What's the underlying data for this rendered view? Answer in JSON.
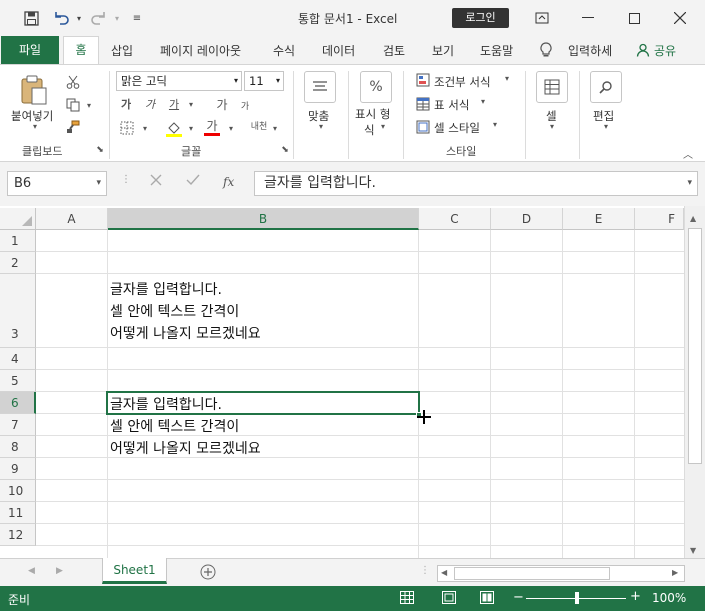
{
  "titlebar": {
    "title": "통합 문서1  -  Excel",
    "login_label": "로그인"
  },
  "tabs": [
    "파일",
    "홈",
    "삽입",
    "페이지 레이아웃",
    "수식",
    "데이터",
    "검토",
    "보기",
    "도움말",
    "입력하세",
    "공유"
  ],
  "ribbon": {
    "clipboard": {
      "paste_label": "붙여넣기",
      "group_label": "클립보드"
    },
    "font": {
      "font_name": "맑은 고딕",
      "font_size": "11",
      "group_label": "글꼴",
      "bold": "가",
      "italic": "가",
      "underline": "가",
      "grow": "가",
      "shrink": "가",
      "color_a": "가",
      "phonetic": "내천"
    },
    "align": {
      "label": "맞춤"
    },
    "number": {
      "label_1": "표시 형",
      "label_2": "식",
      "percent": "%"
    },
    "styles": {
      "cond_format": "조건부 서식",
      "table_format": "표 서식",
      "cell_style": "셀 스타일",
      "group_label": "스타일"
    },
    "cells": {
      "label": "셀"
    },
    "editing": {
      "label": "편집"
    }
  },
  "formula_bar": {
    "name_box": "B6",
    "fx": "fx",
    "formula": "글자를 입력합니다."
  },
  "grid": {
    "columns": [
      "A",
      "B",
      "C",
      "D",
      "E",
      "F"
    ],
    "rows": [
      "1",
      "2",
      "3",
      "4",
      "5",
      "6",
      "7",
      "8",
      "9",
      "10",
      "11",
      "12"
    ],
    "b3_lines": [
      "글자를 입력합니다.",
      "셀 안에 텍스트 간격이",
      "어떻게 나올지 모르겠네요"
    ],
    "b6": "글자를 입력합니다.",
    "b7": "셀 안에 텍스트 간격이",
    "b8": "어떻게 나올지 모르겠네요"
  },
  "sheets": {
    "active": "Sheet1"
  },
  "status": {
    "ready": "준비",
    "zoom": "100%"
  },
  "colors": {
    "accent": "#217346"
  }
}
